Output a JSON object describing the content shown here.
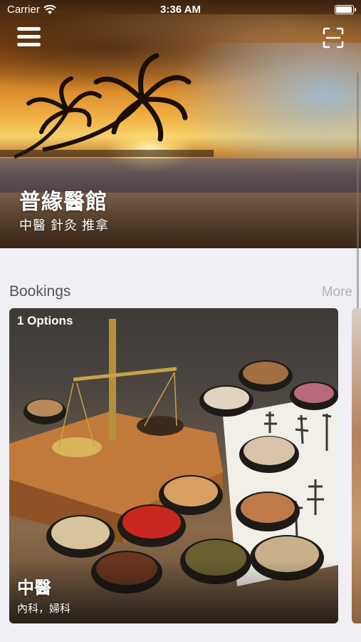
{
  "status_bar": {
    "carrier": "Carrier",
    "time": "3:36 AM",
    "battery_level": 1.0
  },
  "header": {
    "menu_icon": "hamburger-menu-icon",
    "scan_icon": "scan-frame-icon",
    "title": "普緣醫館",
    "subtitle": "中醫 針灸 推拿"
  },
  "bookings": {
    "title": "Bookings",
    "more_label": "More",
    "cards": [
      {
        "options_label": "1 Options",
        "name": "中醫",
        "description": "內科，婦科"
      }
    ]
  },
  "colors": {
    "background": "#efeff4",
    "section_title": "#555555",
    "more_link": "#b5b5b5"
  }
}
